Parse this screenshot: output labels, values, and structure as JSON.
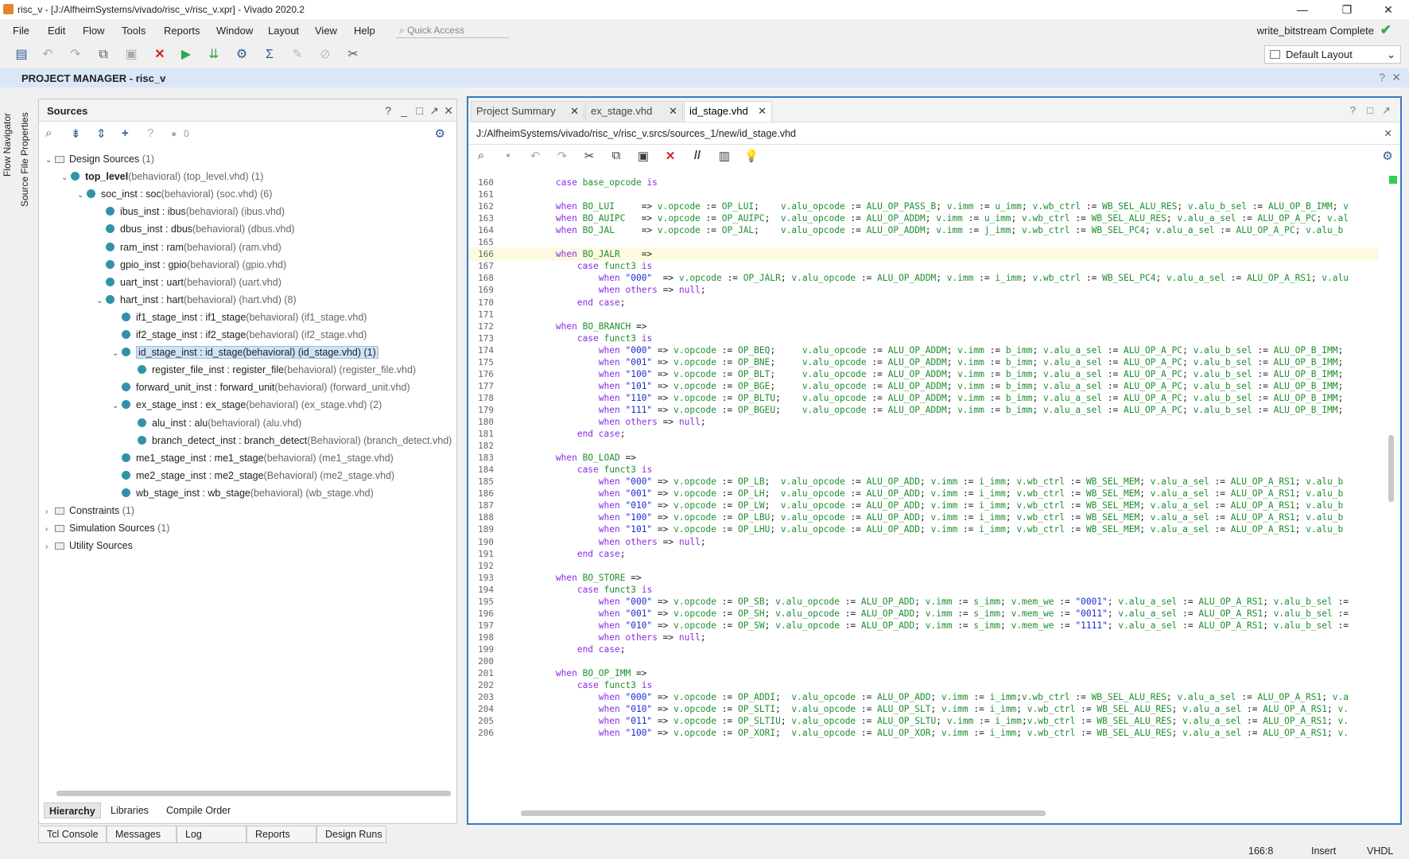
{
  "window": {
    "title": "risc_v - [J:/AlfheimSystems/vivado/risc_v/risc_v.xpr] - Vivado 2020.2",
    "minimize": "—",
    "restore": "❐",
    "close": "✕"
  },
  "menubar": {
    "items": [
      "File",
      "Edit",
      "Flow",
      "Tools",
      "Reports",
      "Window",
      "Layout",
      "View",
      "Help"
    ],
    "quick_access": "Quick Access",
    "status": "write_bitstream Complete"
  },
  "toolbar": {
    "layout_select": "Default Layout"
  },
  "project_manager": {
    "title": "PROJECT MANAGER - risc_v"
  },
  "left_strip": {
    "flow_navigator": "Flow Navigator",
    "source_file_properties": "Source File Properties"
  },
  "sources": {
    "title": "Sources",
    "badge_count": "0",
    "tree": [
      {
        "label": "Design Sources",
        "extra": " (1)",
        "level": 0,
        "type": "folder",
        "open": true
      },
      {
        "label": "top_level",
        "extra": "(behavioral) (top_level.vhd) (1)",
        "level": 1,
        "type": "top",
        "open": true
      },
      {
        "label": "soc_inst : soc",
        "extra": "(behavioral) (soc.vhd) (6)",
        "level": 2,
        "type": "mod",
        "open": true
      },
      {
        "label": "ibus_inst : ibus",
        "extra": "(behavioral) (ibus.vhd)",
        "level": 3,
        "type": "mod"
      },
      {
        "label": "dbus_inst : dbus",
        "extra": "(behavioral) (dbus.vhd)",
        "level": 3,
        "type": "mod"
      },
      {
        "label": "ram_inst : ram",
        "extra": "(behavioral) (ram.vhd)",
        "level": 3,
        "type": "mod"
      },
      {
        "label": "gpio_inst : gpio",
        "extra": "(behavioral) (gpio.vhd)",
        "level": 3,
        "type": "mod"
      },
      {
        "label": "uart_inst : uart",
        "extra": "(behavioral) (uart.vhd)",
        "level": 3,
        "type": "mod"
      },
      {
        "label": "hart_inst : hart",
        "extra": "(behavioral) (hart.vhd) (8)",
        "level": 3,
        "type": "mod",
        "open": true
      },
      {
        "label": "if1_stage_inst : if1_stage",
        "extra": "(behavioral) (if1_stage.vhd)",
        "level": 4,
        "type": "mod"
      },
      {
        "label": "if2_stage_inst : if2_stage",
        "extra": "(behavioral) (if2_stage.vhd)",
        "level": 4,
        "type": "mod"
      },
      {
        "label": "id_stage_inst : id_stage(behavioral) (id_stage.vhd) (1)",
        "extra": "",
        "level": 4,
        "type": "mod",
        "open": true,
        "selected": true
      },
      {
        "label": "register_file_inst : register_file",
        "extra": "(behavioral) (register_file.vhd)",
        "level": 5,
        "type": "mod"
      },
      {
        "label": "forward_unit_inst : forward_unit",
        "extra": "(behavioral) (forward_unit.vhd)",
        "level": 4,
        "type": "mod"
      },
      {
        "label": "ex_stage_inst : ex_stage",
        "extra": "(behavioral) (ex_stage.vhd) (2)",
        "level": 4,
        "type": "mod",
        "open": true
      },
      {
        "label": "alu_inst : alu",
        "extra": "(behavioral) (alu.vhd)",
        "level": 5,
        "type": "mod"
      },
      {
        "label": "branch_detect_inst : branch_detect",
        "extra": "(Behavioral) (branch_detect.vhd)",
        "level": 5,
        "type": "mod"
      },
      {
        "label": "me1_stage_inst : me1_stage",
        "extra": "(behavioral) (me1_stage.vhd)",
        "level": 4,
        "type": "mod"
      },
      {
        "label": "me2_stage_inst : me2_stage",
        "extra": "(Behavioral) (me2_stage.vhd)",
        "level": 4,
        "type": "mod"
      },
      {
        "label": "wb_stage_inst : wb_stage",
        "extra": "(behavioral) (wb_stage.vhd)",
        "level": 4,
        "type": "mod"
      },
      {
        "label": "Constraints",
        "extra": " (1)",
        "level": 0,
        "type": "folder"
      },
      {
        "label": "Simulation Sources",
        "extra": " (1)",
        "level": 0,
        "type": "folder"
      },
      {
        "label": "Utility Sources",
        "extra": "",
        "level": 0,
        "type": "folder"
      }
    ],
    "tabs": [
      "Hierarchy",
      "Libraries",
      "Compile Order"
    ]
  },
  "editor": {
    "tabs": [
      "Project Summary",
      "ex_stage.vhd",
      "id_stage.vhd"
    ],
    "active_tab": 2,
    "path": "J:/AlfheimSystems/vivado/risc_v/risc_v.srcs/sources_1/new/id_stage.vhd",
    "lines": [
      {
        "n": "160",
        "t": "        case base_opcode is"
      },
      {
        "n": "161",
        "t": ""
      },
      {
        "n": "162",
        "t": "        when BO_LUI     => v.opcode := OP_LUI;    v.alu_opcode := ALU_OP_PASS_B; v.imm := u_imm; v.wb_ctrl := WB_SEL_ALU_RES; v.alu_b_sel := ALU_OP_B_IMM; v"
      },
      {
        "n": "163",
        "t": "        when BO_AUIPC   => v.opcode := OP_AUIPC;  v.alu_opcode := ALU_OP_ADDM; v.imm := u_imm; v.wb_ctrl := WB_SEL_ALU_RES; v.alu_a_sel := ALU_OP_A_PC; v.al"
      },
      {
        "n": "164",
        "t": "        when BO_JAL     => v.opcode := OP_JAL;    v.alu_opcode := ALU_OP_ADDM; v.imm := j_imm; v.wb_ctrl := WB_SEL_PC4; v.alu_a_sel := ALU_OP_A_PC; v.alu_b"
      },
      {
        "n": "165",
        "t": ""
      },
      {
        "n": "166",
        "t": "        when BO_JALR    =>"
      },
      {
        "n": "167",
        "t": "            case funct3 is"
      },
      {
        "n": "168",
        "t": "                when \"000\"  => v.opcode := OP_JALR; v.alu_opcode := ALU_OP_ADDM; v.imm := i_imm; v.wb_ctrl := WB_SEL_PC4; v.alu_a_sel := ALU_OP_A_RS1; v.alu"
      },
      {
        "n": "169",
        "t": "                when others => null;"
      },
      {
        "n": "170",
        "t": "            end case;"
      },
      {
        "n": "171",
        "t": ""
      },
      {
        "n": "172",
        "t": "        when BO_BRANCH =>"
      },
      {
        "n": "173",
        "t": "            case funct3 is"
      },
      {
        "n": "174",
        "t": "                when \"000\" => v.opcode := OP_BEQ;     v.alu_opcode := ALU_OP_ADDM; v.imm := b_imm; v.alu_a_sel := ALU_OP_A_PC; v.alu_b_sel := ALU_OP_B_IMM;"
      },
      {
        "n": "175",
        "t": "                when \"001\" => v.opcode := OP_BNE;     v.alu_opcode := ALU_OP_ADDM; v.imm := b_imm; v.alu_a_sel := ALU_OP_A_PC; v.alu_b_sel := ALU_OP_B_IMM;"
      },
      {
        "n": "176",
        "t": "                when \"100\" => v.opcode := OP_BLT;     v.alu_opcode := ALU_OP_ADDM; v.imm := b_imm; v.alu_a_sel := ALU_OP_A_PC; v.alu_b_sel := ALU_OP_B_IMM;"
      },
      {
        "n": "177",
        "t": "                when \"101\" => v.opcode := OP_BGE;     v.alu_opcode := ALU_OP_ADDM; v.imm := b_imm; v.alu_a_sel := ALU_OP_A_PC; v.alu_b_sel := ALU_OP_B_IMM;"
      },
      {
        "n": "178",
        "t": "                when \"110\" => v.opcode := OP_BLTU;    v.alu_opcode := ALU_OP_ADDM; v.imm := b_imm; v.alu_a_sel := ALU_OP_A_PC; v.alu_b_sel := ALU_OP_B_IMM;"
      },
      {
        "n": "179",
        "t": "                when \"111\" => v.opcode := OP_BGEU;    v.alu_opcode := ALU_OP_ADDM; v.imm := b_imm; v.alu_a_sel := ALU_OP_A_PC; v.alu_b_sel := ALU_OP_B_IMM;"
      },
      {
        "n": "180",
        "t": "                when others => null;"
      },
      {
        "n": "181",
        "t": "            end case;"
      },
      {
        "n": "182",
        "t": ""
      },
      {
        "n": "183",
        "t": "        when BO_LOAD =>"
      },
      {
        "n": "184",
        "t": "            case funct3 is"
      },
      {
        "n": "185",
        "t": "                when \"000\" => v.opcode := OP_LB;  v.alu_opcode := ALU_OP_ADD; v.imm := i_imm; v.wb_ctrl := WB_SEL_MEM; v.alu_a_sel := ALU_OP_A_RS1; v.alu_b"
      },
      {
        "n": "186",
        "t": "                when \"001\" => v.opcode := OP_LH;  v.alu_opcode := ALU_OP_ADD; v.imm := i_imm; v.wb_ctrl := WB_SEL_MEM; v.alu_a_sel := ALU_OP_A_RS1; v.alu_b"
      },
      {
        "n": "187",
        "t": "                when \"010\" => v.opcode := OP_LW;  v.alu_opcode := ALU_OP_ADD; v.imm := i_imm; v.wb_ctrl := WB_SEL_MEM; v.alu_a_sel := ALU_OP_A_RS1; v.alu_b"
      },
      {
        "n": "188",
        "t": "                when \"100\" => v.opcode := OP_LBU; v.alu_opcode := ALU_OP_ADD; v.imm := i_imm; v.wb_ctrl := WB_SEL_MEM; v.alu_a_sel := ALU_OP_A_RS1; v.alu_b"
      },
      {
        "n": "189",
        "t": "                when \"101\" => v.opcode := OP_LHU; v.alu_opcode := ALU_OP_ADD; v.imm := i_imm; v.wb_ctrl := WB_SEL_MEM; v.alu_a_sel := ALU_OP_A_RS1; v.alu_b"
      },
      {
        "n": "190",
        "t": "                when others => null;"
      },
      {
        "n": "191",
        "t": "            end case;"
      },
      {
        "n": "192",
        "t": ""
      },
      {
        "n": "193",
        "t": "        when BO_STORE =>"
      },
      {
        "n": "194",
        "t": "            case funct3 is"
      },
      {
        "n": "195",
        "t": "                when \"000\" => v.opcode := OP_SB; v.alu_opcode := ALU_OP_ADD; v.imm := s_imm; v.mem_we := \"0001\"; v.alu_a_sel := ALU_OP_A_RS1; v.alu_b_sel :="
      },
      {
        "n": "196",
        "t": "                when \"001\" => v.opcode := OP_SH; v.alu_opcode := ALU_OP_ADD; v.imm := s_imm; v.mem_we := \"0011\"; v.alu_a_sel := ALU_OP_A_RS1; v.alu_b_sel :="
      },
      {
        "n": "197",
        "t": "                when \"010\" => v.opcode := OP_SW; v.alu_opcode := ALU_OP_ADD; v.imm := s_imm; v.mem_we := \"1111\"; v.alu_a_sel := ALU_OP_A_RS1; v.alu_b_sel :="
      },
      {
        "n": "198",
        "t": "                when others => null;"
      },
      {
        "n": "199",
        "t": "            end case;"
      },
      {
        "n": "200",
        "t": ""
      },
      {
        "n": "201",
        "t": "        when BO_OP_IMM =>"
      },
      {
        "n": "202",
        "t": "            case funct3 is"
      },
      {
        "n": "203",
        "t": "                when \"000\" => v.opcode := OP_ADDI;  v.alu_opcode := ALU_OP_ADD; v.imm := i_imm;v.wb_ctrl := WB_SEL_ALU_RES; v.alu_a_sel := ALU_OP_A_RS1; v.a"
      },
      {
        "n": "204",
        "t": "                when \"010\" => v.opcode := OP_SLTI;  v.alu_opcode := ALU_OP_SLT; v.imm := i_imm; v.wb_ctrl := WB_SEL_ALU_RES; v.alu_a_sel := ALU_OP_A_RS1; v."
      },
      {
        "n": "205",
        "t": "                when \"011\" => v.opcode := OP_SLTIU; v.alu_opcode := ALU_OP_SLTU; v.imm := i_imm;v.wb_ctrl := WB_SEL_ALU_RES; v.alu_a_sel := ALU_OP_A_RS1; v."
      },
      {
        "n": "206",
        "t": "                when \"100\" => v.opcode := OP_XORI;  v.alu_opcode := ALU_OP_XOR; v.imm := i_imm; v.wb_ctrl := WB_SEL_ALU_RES; v.alu_a_sel := ALU_OP_A_RS1; v."
      }
    ],
    "highlight_line": "166"
  },
  "bottom_tabs": [
    "Tcl Console",
    "Messages",
    "Log",
    "Reports",
    "Design Runs"
  ],
  "status": {
    "cursor": "166:8",
    "mode": "Insert",
    "language": "VHDL"
  },
  "colors": {
    "accent": "#3679c5",
    "pm_bar": "#d9e7f7",
    "keyword": "#8a2be2",
    "identifier": "#1e8f2e",
    "string": "#1a2bd5",
    "complete_check": "#35a845"
  }
}
